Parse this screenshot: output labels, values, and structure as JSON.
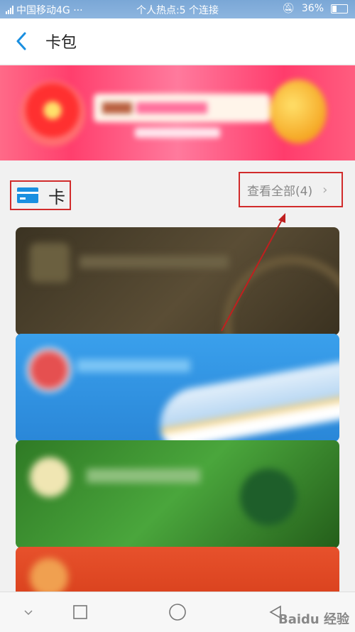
{
  "status_bar": {
    "carrier": "中国移动4G ···",
    "hotspot": "个人热点:5 个连接",
    "battery": "36%"
  },
  "header": {
    "title": "卡包"
  },
  "section": {
    "title": "卡",
    "view_all": "查看全部(4)"
  },
  "annotation": {
    "color": "#d12b2b"
  },
  "watermark": "Baidu 经验",
  "colors": {
    "status_bar": "#7fadd9",
    "accent_blue": "#1a8fe0",
    "highlight_red": "#d12b2b"
  }
}
